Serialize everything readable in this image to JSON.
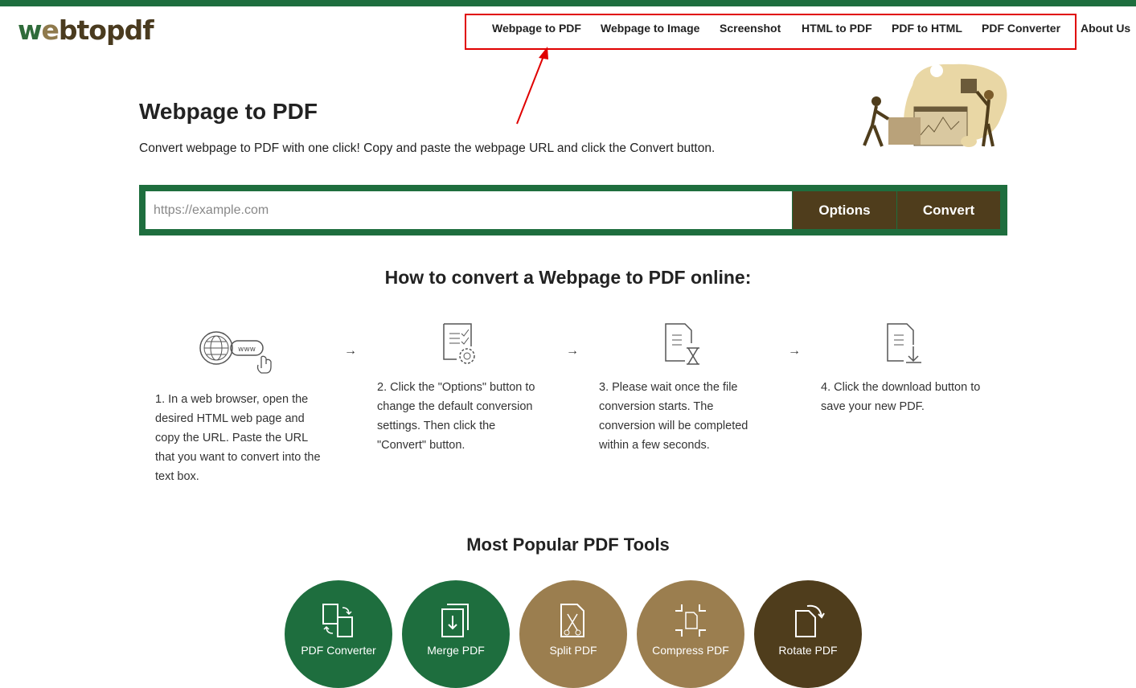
{
  "brand": {
    "logo_text": "webtopdf",
    "green": "#1e6e3e",
    "brown": "#4f3d1c"
  },
  "nav": {
    "items": [
      "Webpage to PDF",
      "Webpage to Image",
      "Screenshot",
      "HTML to PDF",
      "PDF to HTML",
      "PDF Converter",
      "About Us"
    ]
  },
  "hero": {
    "title": "Webpage to PDF",
    "description": "Convert webpage to PDF with one click! Copy and paste the webpage URL and click the Convert button."
  },
  "converter": {
    "placeholder": "https://example.com",
    "options_label": "Options",
    "convert_label": "Convert"
  },
  "how": {
    "title": "How to convert a Webpage to PDF online:",
    "steps": [
      {
        "icon": "www-globe-click-icon",
        "text": "1. In a web browser, open the desired HTML web page and copy the URL. Paste the URL that you want to convert into the text box."
      },
      {
        "icon": "document-settings-icon",
        "text": "2. Click the \"Options\" button to change the default conversion settings. Then click the \"Convert\" button."
      },
      {
        "icon": "document-hourglass-icon",
        "text": "3. Please wait once the file conversion starts. The conversion will be completed within a few seconds."
      },
      {
        "icon": "document-download-icon",
        "text": "4. Click the download button to save your new PDF."
      }
    ],
    "arrow": "→"
  },
  "popular": {
    "title": "Most Popular PDF Tools",
    "tools": [
      {
        "label": "PDF Converter",
        "icon": "convert-icon",
        "color": "#1e6e3e"
      },
      {
        "label": "Merge PDF",
        "icon": "merge-icon",
        "color": "#1e6e3e"
      },
      {
        "label": "Split PDF",
        "icon": "split-icon",
        "color": "#9b7e4f"
      },
      {
        "label": "Compress PDF",
        "icon": "compress-icon",
        "color": "#9b7e4f"
      },
      {
        "label": "Rotate PDF",
        "icon": "rotate-icon",
        "color": "#4f3d1c"
      }
    ]
  }
}
